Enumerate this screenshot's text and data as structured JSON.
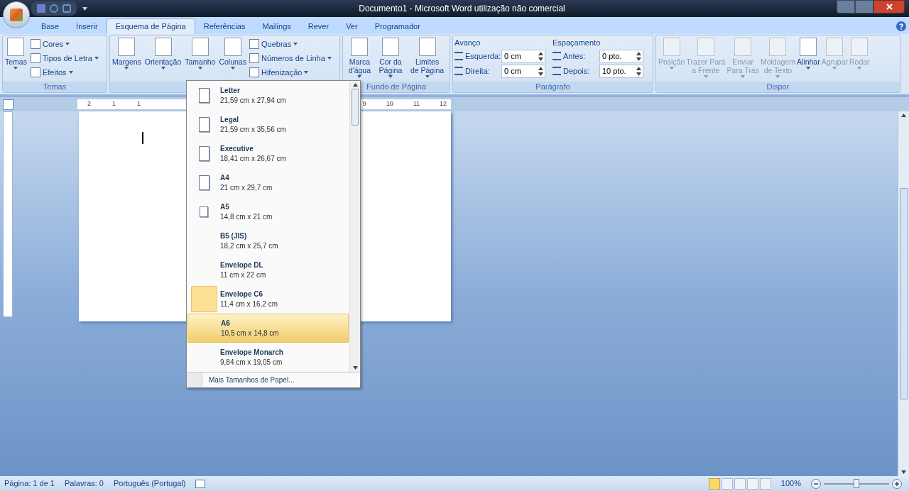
{
  "window": {
    "title": "Documento1 - Microsoft Word utilização não comercial"
  },
  "tabs": [
    {
      "label": "Base",
      "selected": false
    },
    {
      "label": "Inserir",
      "selected": false
    },
    {
      "label": "Esquema de Página",
      "selected": true
    },
    {
      "label": "Referências",
      "selected": false
    },
    {
      "label": "Mailings",
      "selected": false
    },
    {
      "label": "Rever",
      "selected": false
    },
    {
      "label": "Ver",
      "selected": false
    },
    {
      "label": "Programador",
      "selected": false
    }
  ],
  "ribbon": {
    "temas": {
      "label": "Temas",
      "button": "Temas",
      "small": [
        "Cores",
        "Tipos de Letra",
        "Efeitos"
      ]
    },
    "page_setup": {
      "large": [
        "Margens",
        "Orientação",
        "Tamanho",
        "Colunas"
      ],
      "small": [
        "Quebras",
        "Números de Linha",
        "Hifenização"
      ]
    },
    "fundo": {
      "label": "Fundo de Página",
      "buttons": [
        [
          "Marca",
          "d'água"
        ],
        [
          "Cor da",
          "Página"
        ],
        [
          "Limites",
          "de Página"
        ]
      ]
    },
    "paragrafo": {
      "label": "Parágrafo",
      "sections": [
        {
          "title": "Avanço",
          "fields": [
            {
              "label": "Esquerda:",
              "value": "0 cm"
            },
            {
              "label": "Direita:",
              "value": "0 cm"
            }
          ]
        },
        {
          "title": "Espaçamento",
          "fields": [
            {
              "label": "Antes:",
              "value": "0 pto."
            },
            {
              "label": "Depois:",
              "value": "10 pto."
            }
          ]
        }
      ]
    },
    "dispor": {
      "label": "Dispor",
      "buttons": [
        {
          "lines": [
            "Posição"
          ],
          "disabled": true
        },
        {
          "lines": [
            "Trazer Para",
            "a Frente"
          ],
          "disabled": true
        },
        {
          "lines": [
            "Enviar",
            "Para Trás"
          ],
          "disabled": true
        },
        {
          "lines": [
            "Moldagem",
            "de Texto"
          ],
          "disabled": true
        },
        {
          "lines": [
            "Alinhar"
          ],
          "disabled": false
        },
        {
          "lines": [
            "Agrupar"
          ],
          "disabled": true
        },
        {
          "lines": [
            "Rodar"
          ],
          "disabled": true
        }
      ]
    }
  },
  "ruler": {
    "left_labels": [
      "2",
      "1",
      "1"
    ],
    "right_labels": [
      "9",
      "10",
      "11",
      "12"
    ]
  },
  "size_menu": {
    "items": [
      {
        "name": "Letter",
        "size": "21,59 cm x 27,94 cm",
        "kind": "portrait",
        "selected": false,
        "hovered": false
      },
      {
        "name": "Legal",
        "size": "21,59 cm x 35,56 cm",
        "kind": "portrait",
        "selected": false,
        "hovered": false
      },
      {
        "name": "Executive",
        "size": "18,41 cm x 26,67 cm",
        "kind": "portrait",
        "selected": false,
        "hovered": false
      },
      {
        "name": "A4",
        "size": "21 cm x 29,7 cm",
        "kind": "portrait",
        "selected": false,
        "hovered": false
      },
      {
        "name": "A5",
        "size": "14,8 cm x 21 cm",
        "kind": "small",
        "selected": false,
        "hovered": false
      },
      {
        "name": "B5 (JIS)",
        "size": "18,2 cm x 25,7 cm",
        "kind": "blank",
        "selected": false,
        "hovered": false
      },
      {
        "name": "Envelope DL",
        "size": "11 cm x 22 cm",
        "kind": "blank",
        "selected": false,
        "hovered": false
      },
      {
        "name": "Envelope C6",
        "size": "11,4 cm x 16,2 cm",
        "kind": "blank",
        "selected": true,
        "hovered": false
      },
      {
        "name": "A6",
        "size": "10,5 cm x 14,8 cm",
        "kind": "blank",
        "selected": false,
        "hovered": true
      },
      {
        "name": "Envelope Monarch",
        "size": "9,84 cm x 19,05 cm",
        "kind": "blank",
        "selected": false,
        "hovered": false
      }
    ],
    "footer": "Mais Tamanhos de Papel..."
  },
  "status_bar": {
    "page": "Página: 1 de 1",
    "words": "Palavras: 0",
    "language": "Português (Portugal)",
    "views": [
      {
        "selected": true
      },
      {
        "selected": false
      },
      {
        "selected": false
      },
      {
        "selected": false
      },
      {
        "selected": false
      }
    ],
    "zoom": "100%",
    "zoom_slider": {
      "level": 0.5
    }
  }
}
